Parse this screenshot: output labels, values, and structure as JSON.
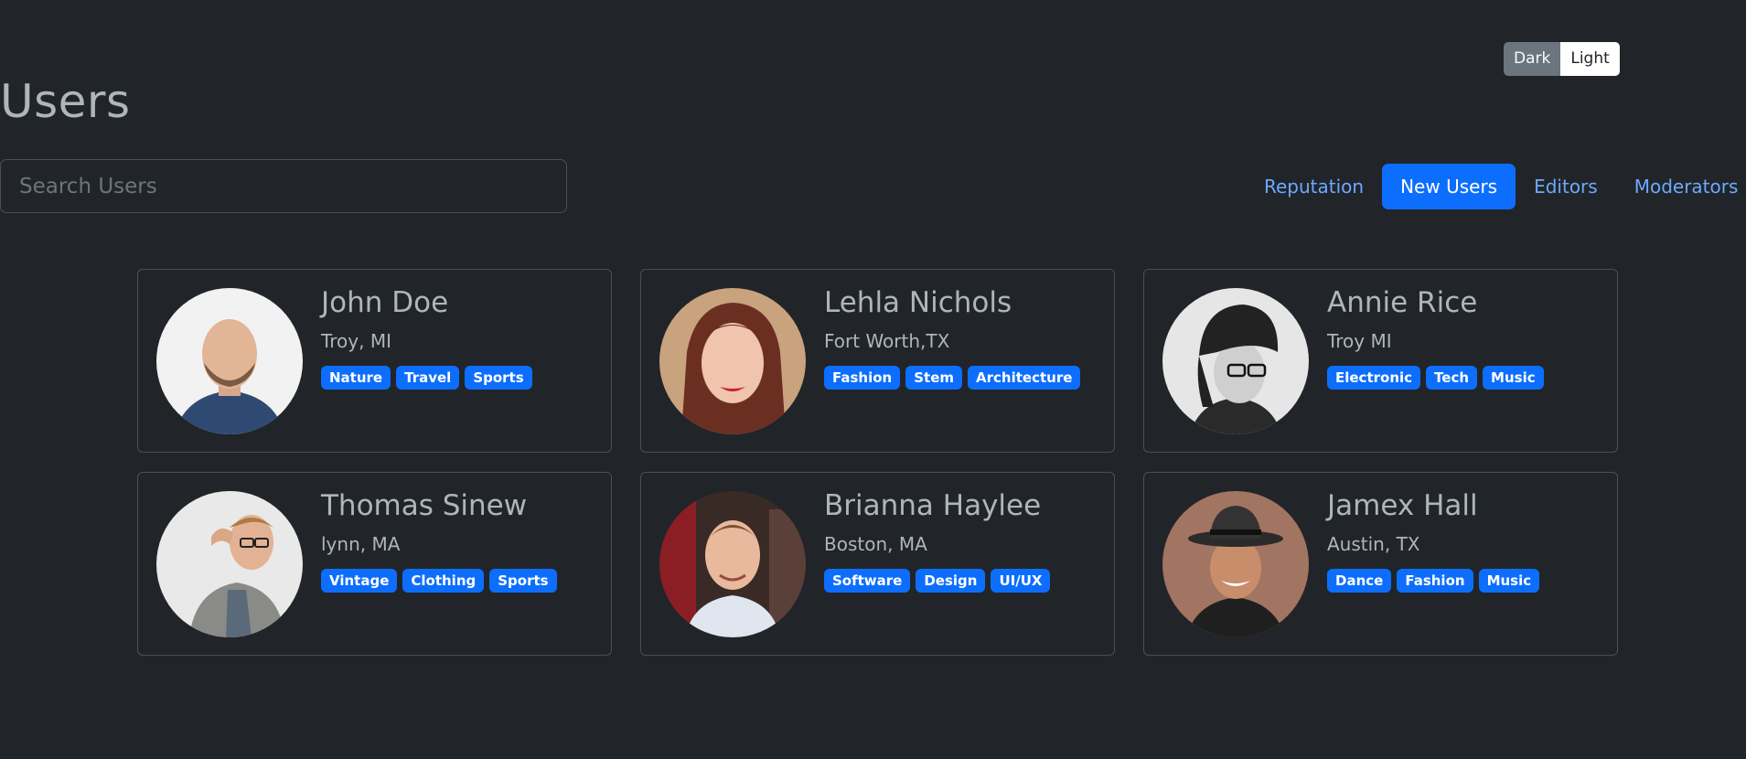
{
  "theme_toggle": {
    "dark_label": "Dark",
    "light_label": "Light"
  },
  "page": {
    "title": "Users"
  },
  "search": {
    "placeholder": "Search Users",
    "value": ""
  },
  "nav": {
    "tabs": [
      {
        "label": "Reputation",
        "active": false
      },
      {
        "label": "New Users",
        "active": true
      },
      {
        "label": "Editors",
        "active": false
      },
      {
        "label": "Moderators",
        "active": false
      }
    ]
  },
  "colors": {
    "background": "#212529",
    "accent": "#0d6efd",
    "link": "#6ea8fe",
    "text": "#adb5bd",
    "border": "#495057"
  },
  "users": [
    {
      "name": "John Doe",
      "location": "Troy, MI",
      "tags": [
        "Nature",
        "Travel",
        "Sports"
      ]
    },
    {
      "name": "Lehla Nichols",
      "location": "Fort Worth,TX",
      "tags": [
        "Fashion",
        "Stem",
        "Architecture"
      ]
    },
    {
      "name": "Annie Rice",
      "location": "Troy MI",
      "tags": [
        "Electronic",
        "Tech",
        "Music"
      ]
    },
    {
      "name": "Thomas Sinew",
      "location": "lynn, MA",
      "tags": [
        "Vintage",
        "Clothing",
        "Sports"
      ]
    },
    {
      "name": "Brianna Haylee",
      "location": "Boston, MA",
      "tags": [
        "Software",
        "Design",
        "UI/UX"
      ]
    },
    {
      "name": "Jamex Hall",
      "location": "Austin, TX",
      "tags": [
        "Dance",
        "Fashion",
        "Music"
      ]
    }
  ]
}
